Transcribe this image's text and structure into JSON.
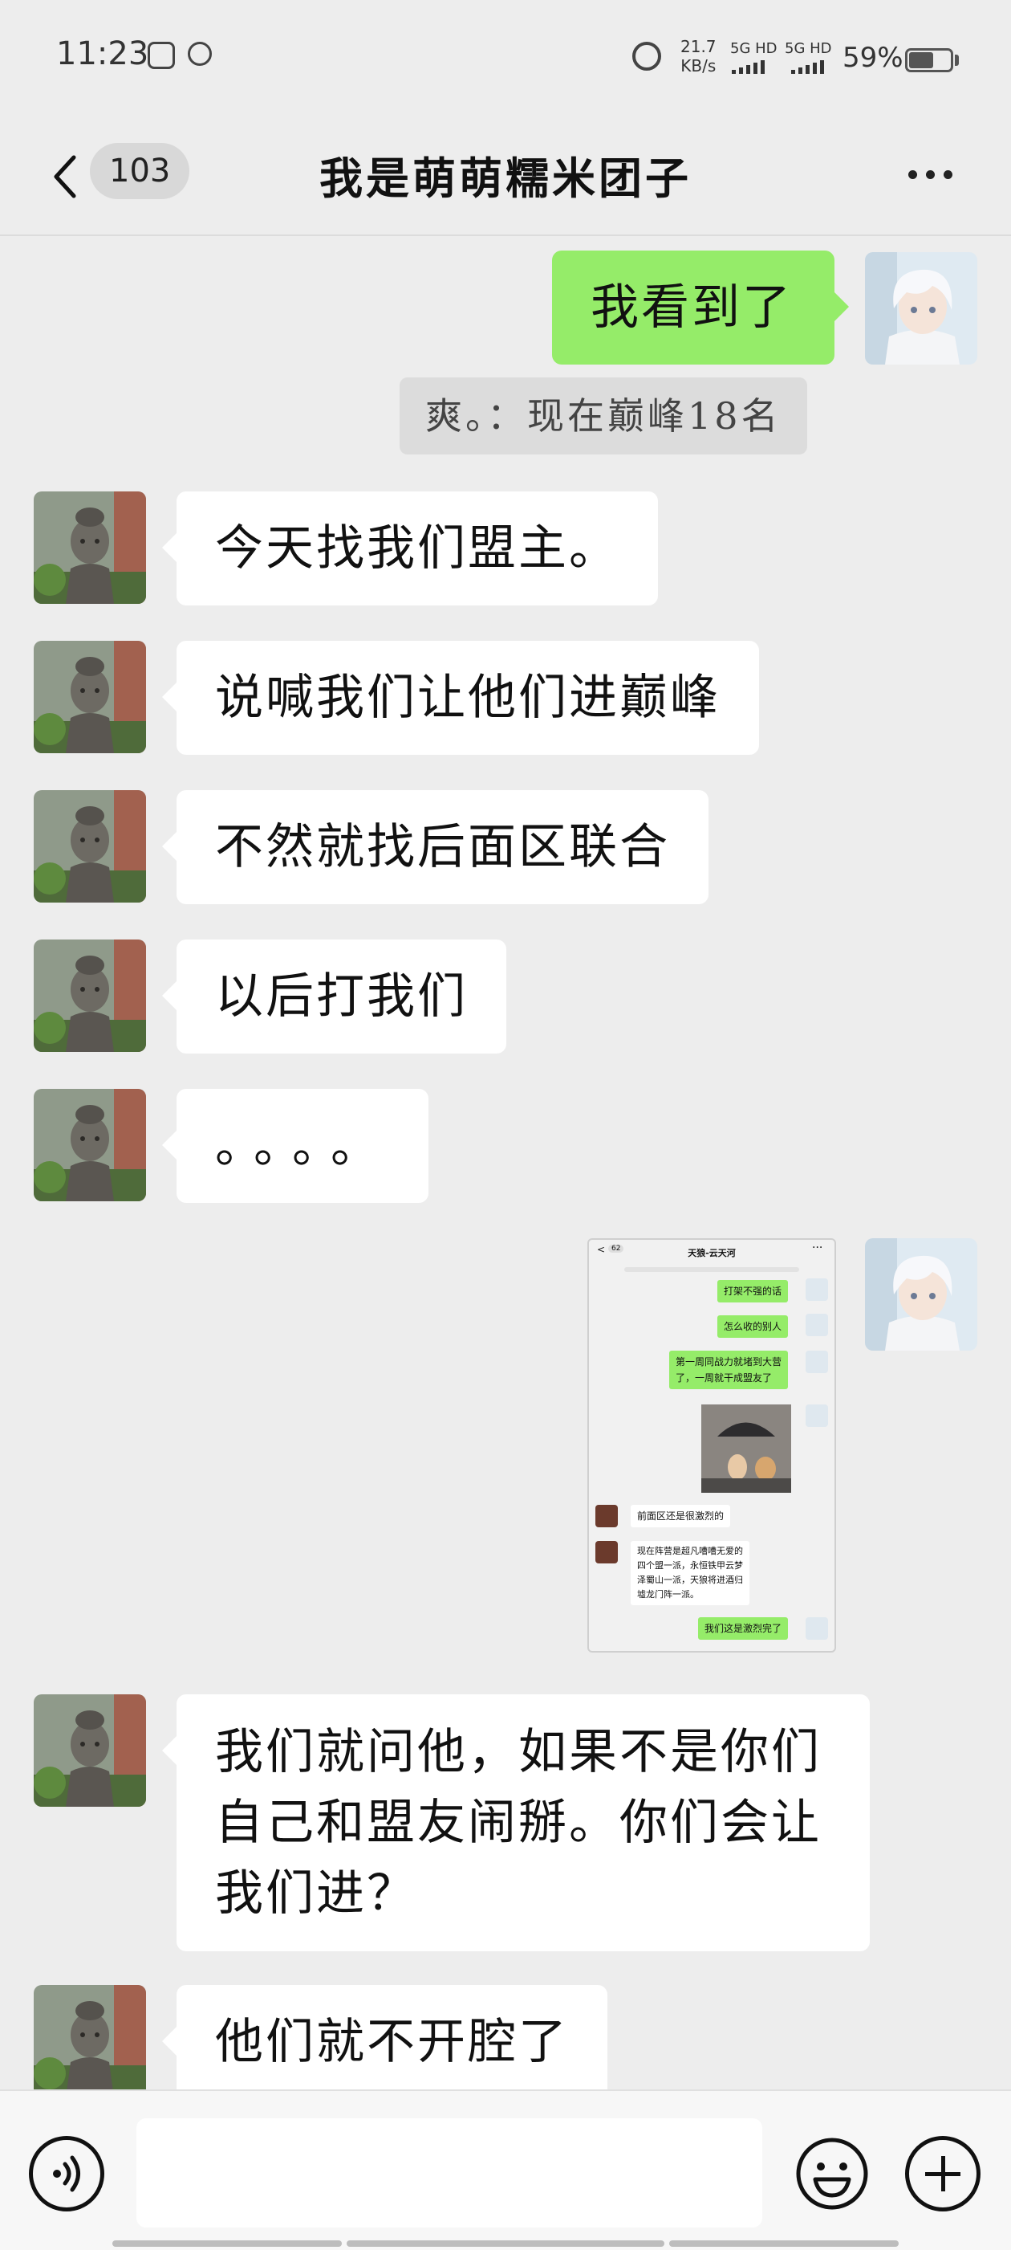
{
  "status_bar": {
    "time": "11:23",
    "net_speed_value": "21.7",
    "net_speed_unit": "KB/s",
    "sim1": "5G HD",
    "sim2": "5G HD",
    "battery_pct": "59%",
    "battery_level": 0.59
  },
  "nav": {
    "unread_count": "103",
    "title": "我是萌萌糯米团子"
  },
  "messages": [
    {
      "side": "right",
      "type": "text",
      "text": "我看到了"
    },
    {
      "side": "right",
      "type": "quote",
      "text": "爽。：现在巅峰18名"
    },
    {
      "side": "left",
      "type": "text",
      "text": "今天找我们盟主。"
    },
    {
      "side": "left",
      "type": "text",
      "text": "说喊我们让他们进巅峰"
    },
    {
      "side": "left",
      "type": "text",
      "text": "不然就找后面区联合"
    },
    {
      "side": "left",
      "type": "text",
      "text": "以后打我们"
    },
    {
      "side": "left",
      "type": "text",
      "text": "。。。。"
    },
    {
      "side": "right",
      "type": "image",
      "text": ""
    },
    {
      "side": "left",
      "type": "text",
      "text": "我们就问他，如果不是你们自己和盟友闹掰。你们会让我们进？"
    },
    {
      "side": "left",
      "type": "text",
      "text": "他们就不开腔了"
    }
  ],
  "shared_screenshot": {
    "count": "62",
    "title": "天狼-云天河",
    "msgs": [
      "打架不强的话",
      "怎么收的别人",
      "第一周同战力就堵到大营\n了，一周就干成盟友了",
      "前面区还是很激烈的",
      "现在阵营是超凡嘈嘈无爱的\n四个盟一派，永恒铁甲云梦\n泽蜀山一派，天狼将进酒归\n墟龙门阵一派。",
      "我们这是激烈完了"
    ]
  },
  "input": {
    "placeholder": ""
  },
  "colors": {
    "background": "#ededed",
    "my_bubble": "#95ec69",
    "their_bubble": "#ffffff",
    "quote_bg": "#dcdcdc"
  },
  "icons": [
    "back-icon",
    "more-icon",
    "alarm-icon",
    "battery-icon",
    "voice-icon",
    "emoji-icon",
    "plus-icon"
  ]
}
